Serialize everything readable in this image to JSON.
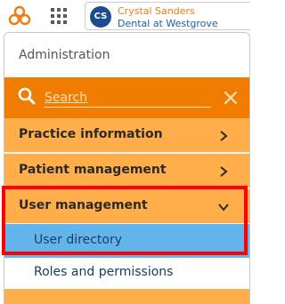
{
  "user": {
    "initials": "CS",
    "name": "Crystal Sanders",
    "org": "Dental at Westgrove"
  },
  "menu": {
    "heading": "Administration",
    "search": {
      "placeholder": "Search"
    },
    "items": [
      {
        "label": "Practice information",
        "state": "collapsed"
      },
      {
        "label": "Patient management",
        "state": "collapsed"
      },
      {
        "label": "User management",
        "state": "expanded"
      }
    ],
    "sub_items": [
      {
        "label": "User directory",
        "selected": true
      },
      {
        "label": "Roles and permissions",
        "selected": false
      }
    ]
  },
  "colors": {
    "brand_orange": "#f07d00",
    "item_bg": "#ffae4a",
    "selected_bg": "#62b4ea",
    "highlight": "#ff0000",
    "avatar": "#1e4b8f"
  },
  "icons": {
    "logo": "brand-logo-icon",
    "apps": "apps-grid-icon",
    "search": "search-icon",
    "close": "close-icon",
    "collapsed": "chevron-right-icon",
    "expanded": "chevron-down-icon"
  }
}
